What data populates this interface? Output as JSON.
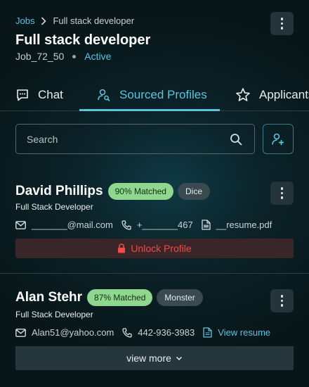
{
  "breadcrumb": {
    "parent": "Jobs",
    "current": "Full stack developer"
  },
  "job": {
    "title": "Full stack developer",
    "id": "Job_72_50",
    "status": "Active"
  },
  "tabs": [
    {
      "label": "Chat",
      "icon": "chat-icon"
    },
    {
      "label": "Sourced Profiles",
      "icon": "user-search-icon",
      "active": true
    },
    {
      "label": "Applicants",
      "icon": "star-icon"
    }
  ],
  "search": {
    "placeholder": "Search"
  },
  "candidates": [
    {
      "name": "David Phillips",
      "match": "90% Matched",
      "source": "Dice",
      "title": "Full Stack Developer",
      "email": "_______@mail.com",
      "phone": "+_______467",
      "resume": "__resume.pdf",
      "action": "Unlock Profile"
    },
    {
      "name": "Alan Stehr",
      "match": "87% Matched",
      "source": "Monster",
      "title": "Full Stack Developer",
      "email": "Alan51@yahoo.com",
      "phone": "442-936-3983",
      "resume": "View resume",
      "action": "view more"
    }
  ],
  "colors": {
    "accent": "#5bc3dd",
    "match_badge": "#8fd68e",
    "unlock_text": "#ee4b4b",
    "background": "#0b2228"
  }
}
